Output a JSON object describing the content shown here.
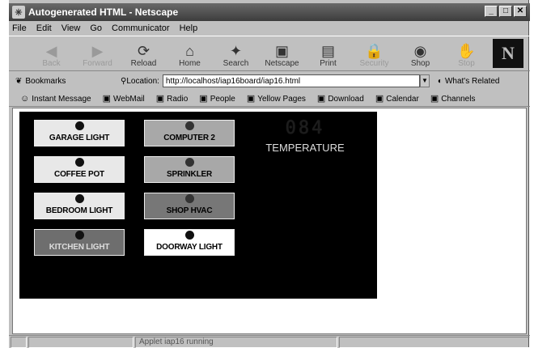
{
  "window": {
    "title": "Autogenerated HTML - Netscape"
  },
  "menu": [
    "File",
    "Edit",
    "View",
    "Go",
    "Communicator",
    "Help"
  ],
  "toolbar": [
    {
      "label": "Back",
      "icon": "back-arrow-icon",
      "glyph": "◀",
      "enabled": false
    },
    {
      "label": "Forward",
      "icon": "forward-arrow-icon",
      "glyph": "▶",
      "enabled": false
    },
    {
      "label": "Reload",
      "icon": "reload-icon",
      "glyph": "⟳",
      "enabled": true
    },
    {
      "label": "Home",
      "icon": "home-icon",
      "glyph": "⌂",
      "enabled": true
    },
    {
      "label": "Search",
      "icon": "search-icon",
      "glyph": "✦",
      "enabled": true
    },
    {
      "label": "Netscape",
      "icon": "netscape-icon",
      "glyph": "▣",
      "enabled": true
    },
    {
      "label": "Print",
      "icon": "print-icon",
      "glyph": "▤",
      "enabled": true
    },
    {
      "label": "Security",
      "icon": "security-lock-icon",
      "glyph": "🔒",
      "enabled": false
    },
    {
      "label": "Shop",
      "icon": "shop-icon",
      "glyph": "◉",
      "enabled": true
    },
    {
      "label": "Stop",
      "icon": "stop-icon",
      "glyph": "✋",
      "enabled": false
    }
  ],
  "locationbar": {
    "bookmarks_label": "Bookmarks",
    "location_label": "Location:",
    "url": "http://localhost/iap16board/iap16.html",
    "whats_related": "What's Related"
  },
  "personal_toolbar": [
    "Instant Message",
    "WebMail",
    "Radio",
    "People",
    "Yellow Pages",
    "Download",
    "Calendar",
    "Channels"
  ],
  "switches": [
    {
      "label": "GARAGE LIGHT",
      "state": "light"
    },
    {
      "label": "COFFEE POT",
      "state": "light"
    },
    {
      "label": "BEDROOM LIGHT",
      "state": "light"
    },
    {
      "label": "KITCHEN LIGHT",
      "state": "darker"
    },
    {
      "label": "COMPUTER 2",
      "state": "mid"
    },
    {
      "label": "SPRINKLER",
      "state": "mid"
    },
    {
      "label": "SHOP HVAC",
      "state": "dark"
    },
    {
      "label": "DOORWAY LIGHT",
      "state": "on"
    }
  ],
  "temperature": {
    "value": "084",
    "label": "TEMPERATURE"
  },
  "status": {
    "text": "Applet iap16 running"
  }
}
